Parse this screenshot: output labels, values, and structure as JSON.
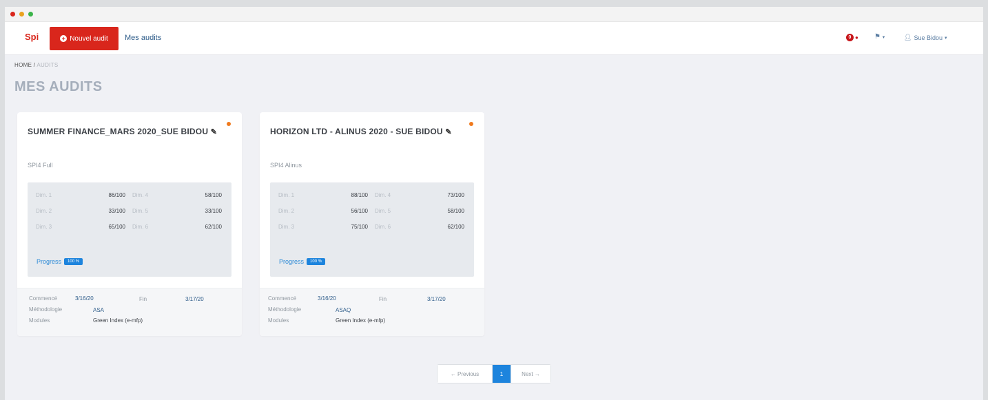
{
  "window": {
    "controls": {
      "close": "#d9261c",
      "minimize": "#e9a21f",
      "zoom": "#3bb44a"
    }
  },
  "navbar": {
    "brand": "Spi",
    "new_audit_label": "Nouvel audit",
    "my_audits_link": "Mes audits",
    "notification_count": "0",
    "user_name": "Sue Bidou"
  },
  "breadcrumb": {
    "home": "HOME",
    "separator": "/",
    "current": "AUDITS"
  },
  "page_title": "MES AUDITS",
  "audits": [
    {
      "title": "SUMMER FINANCE_MARS 2020_SUE BIDOU",
      "subtitle": "SPI4 Full",
      "scores": [
        {
          "label_a": "Dim. 1",
          "value_a": "86/100",
          "label_b": "Dim. 4",
          "value_b": "58/100"
        },
        {
          "label_a": "Dim. 2",
          "value_a": "33/100",
          "label_b": "Dim. 5",
          "value_b": "33/100"
        },
        {
          "label_a": "Dim. 3",
          "value_a": "65/100",
          "label_b": "Dim. 6",
          "value_b": "62/100"
        }
      ],
      "progress_label": "Progress",
      "progress_value": "100 %",
      "footer": {
        "started_label": "Commencé",
        "started_value": "3/16/20",
        "end_label": "Fin",
        "end_value": "3/17/20",
        "method_label": "Méthodologie",
        "method_value": "ASA",
        "modules_label": "Modules",
        "modules_value": "Green Index (e-mfp)"
      }
    },
    {
      "title": "HORIZON LTD - ALINUS 2020 - SUE BIDOU",
      "subtitle": "SPI4 Alinus",
      "scores": [
        {
          "label_a": "Dim. 1",
          "value_a": "88/100",
          "label_b": "Dim. 4",
          "value_b": "73/100"
        },
        {
          "label_a": "Dim. 2",
          "value_a": "56/100",
          "label_b": "Dim. 5",
          "value_b": "58/100"
        },
        {
          "label_a": "Dim. 3",
          "value_a": "75/100",
          "label_b": "Dim. 6",
          "value_b": "62/100"
        }
      ],
      "progress_label": "Progress",
      "progress_value": "100 %",
      "footer": {
        "started_label": "Commencé",
        "started_value": "3/16/20",
        "end_label": "Fin",
        "end_value": "3/17/20",
        "method_label": "Méthodologie",
        "method_value": "ASAQ",
        "modules_label": "Modules",
        "modules_value": "Green Index (e-mfp)"
      }
    }
  ],
  "pagination": {
    "previous": "← Previous",
    "current": "1",
    "next": "Next →"
  }
}
